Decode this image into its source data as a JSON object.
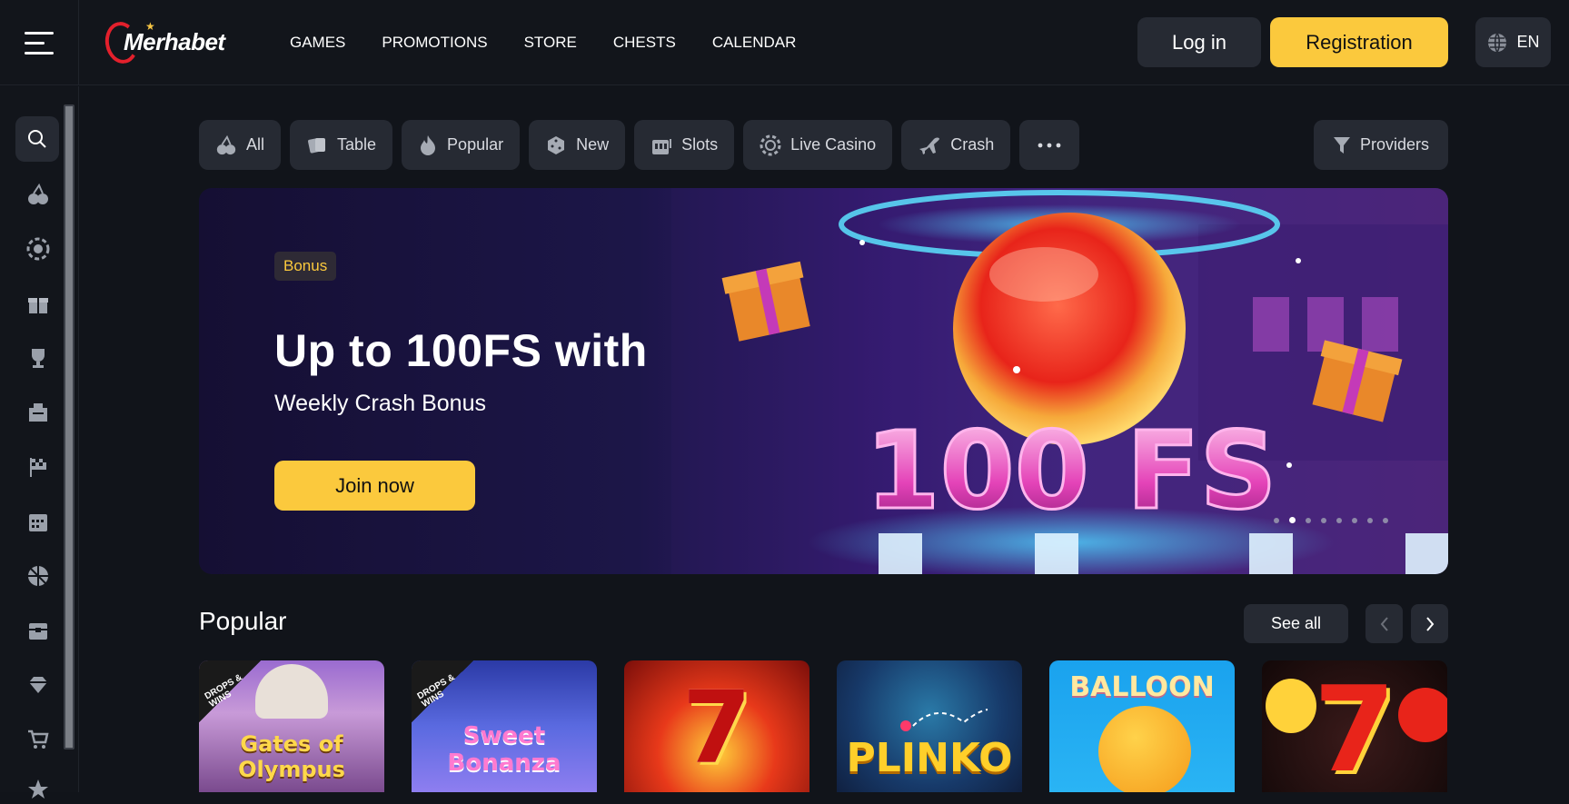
{
  "header": {
    "logo_text": "Merhabet",
    "nav": [
      "GAMES",
      "PROMOTIONS",
      "STORE",
      "CHESTS",
      "CALENDAR"
    ],
    "login_label": "Log in",
    "registration_label": "Registration",
    "language": "EN",
    "accent": "#fbc93d"
  },
  "sidebar": {
    "icons": [
      "search-icon",
      "cherries-icon",
      "live-casino-icon",
      "gift-icon",
      "trophy-icon",
      "ticket-icon",
      "flag-icon",
      "calendar-icon",
      "sports-ball-icon",
      "chest-icon",
      "diamond-icon",
      "cart-icon",
      "star-icon"
    ]
  },
  "filters": {
    "chips": [
      {
        "label": "All",
        "icon": "cherries-icon"
      },
      {
        "label": "Table",
        "icon": "cards-icon"
      },
      {
        "label": "Popular",
        "icon": "fire-icon"
      },
      {
        "label": "New",
        "icon": "dice-icon"
      },
      {
        "label": "Slots",
        "icon": "slot-machine-icon"
      },
      {
        "label": "Live Casino",
        "icon": "chip-icon"
      },
      {
        "label": "Crash",
        "icon": "plane-icon"
      }
    ],
    "more_label": "···",
    "providers_label": "Providers"
  },
  "banner": {
    "badge": "Bonus",
    "title": "Up to 100FS with",
    "subtitle": "Weekly Crash Bonus",
    "cta": "Join now",
    "art_text": "100 FS",
    "slides": 8,
    "active_slide": 2
  },
  "popular": {
    "title": "Popular",
    "see_all": "See all",
    "games": [
      {
        "name": "Gates of Olympus",
        "ribbon": "DROPS & WINS"
      },
      {
        "name": "Sweet Bonanza",
        "ribbon": "DROPS & WINS"
      },
      {
        "name": "7",
        "ribbon": ""
      },
      {
        "name": "PLINKO",
        "ribbon": ""
      },
      {
        "name": "BALLOON",
        "ribbon": ""
      },
      {
        "name": "7",
        "ribbon": ""
      }
    ]
  }
}
